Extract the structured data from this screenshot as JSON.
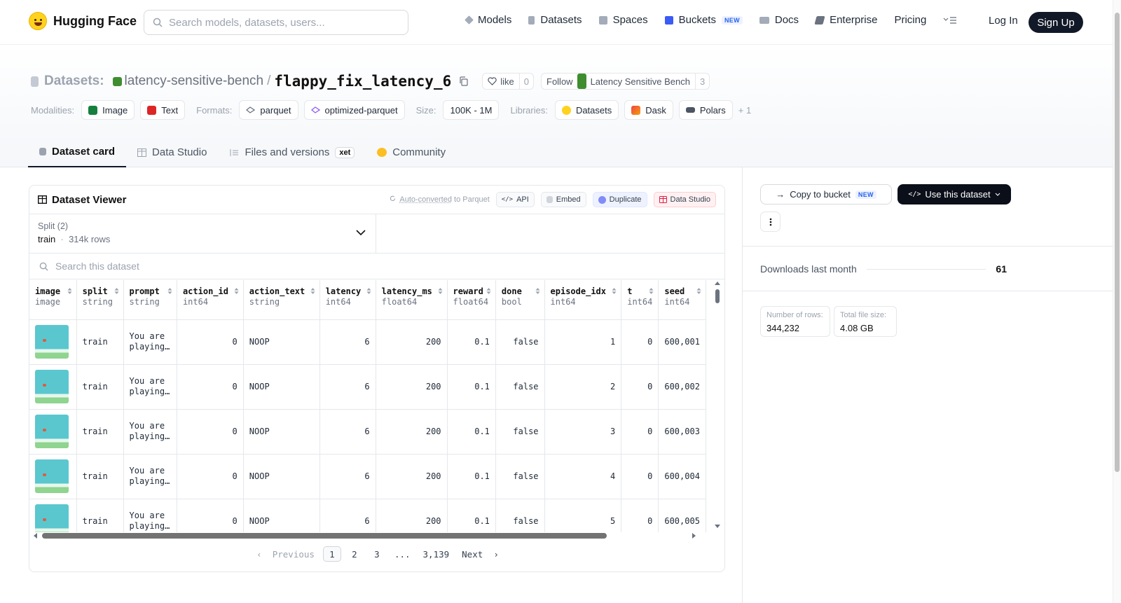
{
  "nav": {
    "brand": "Hugging Face",
    "search_placeholder": "Search models, datasets, users...",
    "links": [
      "Models",
      "Datasets",
      "Spaces",
      "Buckets",
      "Docs",
      "Enterprise",
      "Pricing"
    ],
    "new_badge": "NEW",
    "login": "Log In",
    "signup": "Sign Up"
  },
  "header": {
    "section": "Datasets:",
    "org": "latency-sensitive-bench",
    "separator": "/",
    "name": "flappy_fix_latency_6",
    "like_label": "like",
    "like_count": "0",
    "follow_label": "Follow",
    "follow_org": "Latency Sensitive Bench",
    "follow_count": "3"
  },
  "meta": {
    "modalities_label": "Modalities:",
    "modalities": [
      "Image",
      "Text"
    ],
    "formats_label": "Formats:",
    "formats": [
      "parquet",
      "optimized-parquet"
    ],
    "size_label": "Size:",
    "size": "100K - 1M",
    "libraries_label": "Libraries:",
    "libraries": [
      "Datasets",
      "Dask",
      "Polars"
    ],
    "more_libraries": "+ 1"
  },
  "tabs": [
    "Dataset card",
    "Data Studio",
    "Files and versions",
    "Community"
  ],
  "xet_badge": "xet",
  "viewer": {
    "title": "Dataset Viewer",
    "auto_converted_1": "Auto-converted",
    "auto_converted_2": " to Parquet",
    "api": "API",
    "embed": "Embed",
    "duplicate": "Duplicate",
    "data_studio": "Data Studio",
    "split_label": "Split (2)",
    "split_value": "train",
    "split_rows": "314k rows",
    "search_placeholder": "Search this dataset",
    "columns": [
      {
        "name": "image",
        "type": "image"
      },
      {
        "name": "split",
        "type": "string"
      },
      {
        "name": "prompt",
        "type": "string"
      },
      {
        "name": "action_id",
        "type": "int64"
      },
      {
        "name": "action_text",
        "type": "string"
      },
      {
        "name": "latency",
        "type": "int64"
      },
      {
        "name": "latency_ms",
        "type": "float64"
      },
      {
        "name": "reward",
        "type": "float64"
      },
      {
        "name": "done",
        "type": "bool"
      },
      {
        "name": "episode_idx",
        "type": "int64"
      },
      {
        "name": "t",
        "type": "int64"
      },
      {
        "name": "seed",
        "type": "int64"
      }
    ],
    "rows": [
      [
        "",
        "train",
        "You are playing…",
        "0",
        "NOOP",
        "6",
        "200",
        "0.1",
        "false",
        "1",
        "0",
        "600,001"
      ],
      [
        "",
        "train",
        "You are playing…",
        "0",
        "NOOP",
        "6",
        "200",
        "0.1",
        "false",
        "2",
        "0",
        "600,002"
      ],
      [
        "",
        "train",
        "You are playing…",
        "0",
        "NOOP",
        "6",
        "200",
        "0.1",
        "false",
        "3",
        "0",
        "600,003"
      ],
      [
        "",
        "train",
        "You are playing…",
        "0",
        "NOOP",
        "6",
        "200",
        "0.1",
        "false",
        "4",
        "0",
        "600,004"
      ],
      [
        "",
        "train",
        "You are playing…",
        "0",
        "NOOP",
        "6",
        "200",
        "0.1",
        "false",
        "5",
        "0",
        "600,005"
      ]
    ],
    "pager": {
      "previous": "Previous",
      "pages": [
        "1",
        "2",
        "3",
        "...",
        "3,139"
      ],
      "current": "1",
      "next": "Next"
    }
  },
  "sidebar": {
    "copy_to_bucket": "Copy to bucket",
    "new_badge": "NEW",
    "use_dataset": "Use this dataset",
    "downloads_label": "Downloads last month",
    "downloads_value": "61",
    "rows_label": "Number of rows:",
    "rows_value": "344,232",
    "size_label": "Total file size:",
    "size_value": "4.08 GB"
  }
}
